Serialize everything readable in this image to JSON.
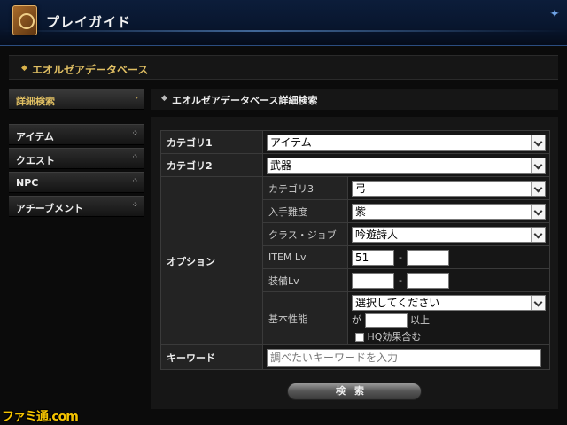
{
  "header": {
    "title": "プレイガイド"
  },
  "database_bar": {
    "label": "エオルゼアデータベース"
  },
  "sidebar": {
    "active_label": "詳細検索",
    "items": [
      {
        "label": "アイテム"
      },
      {
        "label": "クエスト"
      },
      {
        "label": "NPC"
      },
      {
        "label": "アチーブメント"
      }
    ]
  },
  "main": {
    "heading": "エオルゼアデータベース詳細検索"
  },
  "form": {
    "category1": {
      "label": "カテゴリ1",
      "value": "アイテム"
    },
    "category2": {
      "label": "カテゴリ2",
      "value": "武器"
    },
    "options": {
      "label": "オプション",
      "category3": {
        "label": "カテゴリ3",
        "value": "弓"
      },
      "difficulty": {
        "label": "入手難度",
        "value": "紫"
      },
      "class_job": {
        "label": "クラス・ジョブ",
        "value": "吟遊詩人"
      },
      "item_lv": {
        "label": "ITEM Lv",
        "min": "51",
        "max": "",
        "separator": "-"
      },
      "equip_lv": {
        "label": "装備Lv",
        "min": "",
        "max": "",
        "separator": "-"
      },
      "base_stats": {
        "label": "基本性能",
        "select_value": "選択してください",
        "prefix": "が",
        "suffix": "以上",
        "hq_label": "HQ効果含む"
      }
    },
    "keyword": {
      "label": "キーワード",
      "placeholder": "調べたいキーワードを入力"
    }
  },
  "search_button": {
    "label": "検索"
  },
  "watermark": {
    "text": "ファミ通.com"
  }
}
